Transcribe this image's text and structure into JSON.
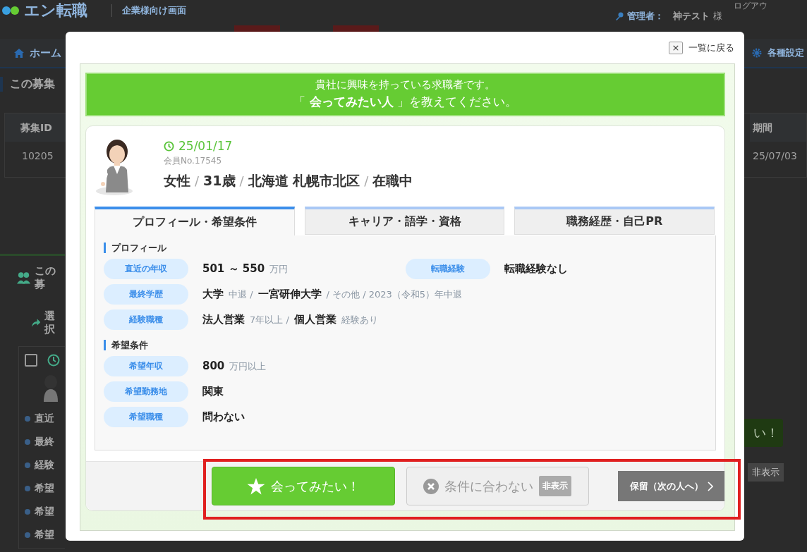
{
  "header": {
    "logo": "エン転職",
    "subtitle": "企業様向け画面",
    "admin_label": "管理者：",
    "admin_name": "神テスト",
    "admin_suffix": "様",
    "logout": "ログアウ"
  },
  "nav": {
    "home": "ホーム",
    "settings": "各種設定"
  },
  "background": {
    "section_title": "この募集",
    "table": {
      "columns": [
        "募集ID",
        "期間"
      ],
      "row": [
        "10205",
        "25/07/03"
      ]
    },
    "applicants_title": "この募",
    "select_label": "選択",
    "checkbox_checked": false,
    "list_items": [
      "直近",
      "最終",
      "経験",
      "希望",
      "希望",
      "希望"
    ],
    "meet_button": "い！",
    "hide_badge": "非表示"
  },
  "modal": {
    "back_label": "一覧に戻る",
    "close_icon": "×",
    "banner": {
      "line1": "貴社に興味を持っている求職者です。",
      "line2": "「 **会ってみたい人** 」を教えてください。"
    },
    "candidate": {
      "date": "25/01/17",
      "member_no": "会員No.17545",
      "summary": [
        {
          "kind": "value",
          "text": "女性"
        },
        {
          "kind": "sep",
          "text": "/"
        },
        {
          "kind": "value",
          "text": "31歳"
        },
        {
          "kind": "sep",
          "text": "/"
        },
        {
          "kind": "value",
          "text": "北海道 札幌市北区"
        },
        {
          "kind": "sep",
          "text": "/"
        },
        {
          "kind": "value",
          "text": "在職中"
        }
      ]
    },
    "tabs": [
      {
        "label": "プロフィール・希望条件",
        "selected": true
      },
      {
        "label": "キャリア・語学・資格",
        "selected": false
      },
      {
        "label": "職務経歴・自己PR",
        "selected": false
      }
    ],
    "sections": [
      {
        "title": "プロフィール",
        "rows": [
          {
            "cells": [
              {
                "label": "直近の年収",
                "parts": [
                  {
                    "kind": "strong",
                    "text": "501 ～ 550"
                  },
                  {
                    "kind": "sub",
                    "text": "万円"
                  }
                ]
              },
              {
                "label": "転職経験",
                "parts": [
                  {
                    "kind": "strong",
                    "text": "転職経験なし"
                  }
                ]
              }
            ]
          },
          {
            "cells": [
              {
                "label": "最終学歴",
                "parts": [
                  {
                    "kind": "strong",
                    "text": "大学"
                  },
                  {
                    "kind": "sub",
                    "text": "中退 /"
                  },
                  {
                    "kind": "strong",
                    "text": "一宮研伸大学"
                  },
                  {
                    "kind": "sub",
                    "text": "/ その他 / 2023（令和5）年中退"
                  }
                ]
              }
            ]
          },
          {
            "cells": [
              {
                "label": "経験職種",
                "parts": [
                  {
                    "kind": "strong",
                    "text": "法人営業"
                  },
                  {
                    "kind": "sub",
                    "text": "7年以上 /"
                  },
                  {
                    "kind": "strong",
                    "text": "個人営業"
                  },
                  {
                    "kind": "sub",
                    "text": "経験あり"
                  }
                ]
              }
            ]
          }
        ]
      },
      {
        "title": "希望条件",
        "rows": [
          {
            "cells": [
              {
                "label": "希望年収",
                "parts": [
                  {
                    "kind": "strong",
                    "text": "800"
                  },
                  {
                    "kind": "sub",
                    "text": "万円以上"
                  }
                ]
              }
            ]
          },
          {
            "cells": [
              {
                "label": "希望勤務地",
                "parts": [
                  {
                    "kind": "strong",
                    "text": "関東"
                  }
                ]
              }
            ]
          },
          {
            "cells": [
              {
                "label": "希望職種",
                "parts": [
                  {
                    "kind": "strong",
                    "text": "問わない"
                  }
                ]
              }
            ]
          }
        ]
      }
    ],
    "actions": {
      "meet": "会ってみたい！",
      "reject": "条件に合わない",
      "reject_badge": "非表示",
      "hold": "保留（次の人へ）"
    }
  }
}
